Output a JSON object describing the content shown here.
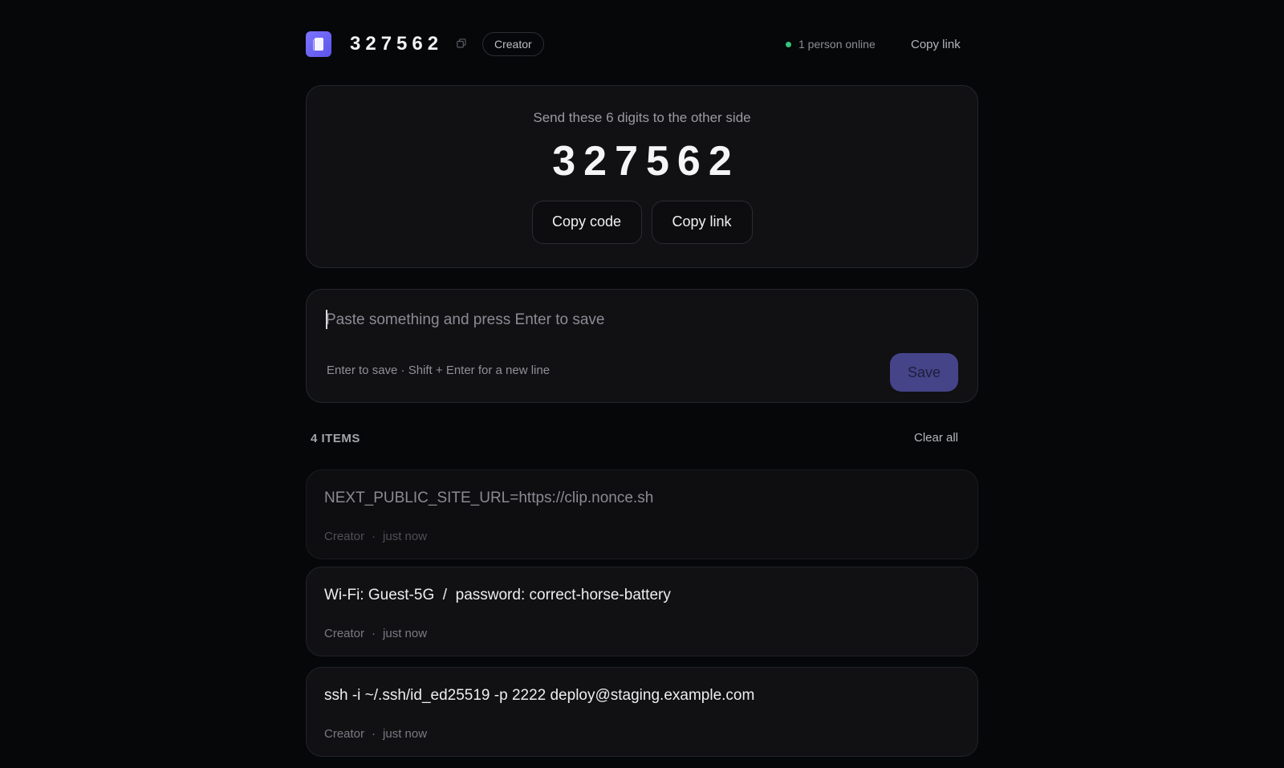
{
  "header": {
    "room_code": "327562",
    "role_badge": "Creator",
    "presence": "1 person online",
    "copy_link": "Copy link"
  },
  "code_card": {
    "instruction": "Send these 6 digits to the other side",
    "code": "327562",
    "copy_code_label": "Copy code",
    "copy_link_label": "Copy link"
  },
  "composer": {
    "placeholder": "Paste something and press Enter to save",
    "value": "",
    "hint": "Enter to save · Shift + Enter for a new line",
    "save_label": "Save"
  },
  "list": {
    "count_label": "4 ITEMS",
    "clear_label": "Clear all",
    "items": [
      {
        "text": "NEXT_PUBLIC_SITE_URL=https://clip.nonce.sh",
        "author": "Creator",
        "sep": "·",
        "time": "just now"
      },
      {
        "text": "Wi-Fi: Guest-5G  /  password: correct-horse-battery",
        "author": "Creator",
        "sep": "·",
        "time": "just now"
      },
      {
        "text": "ssh -i ~/.ssh/id_ed25519 -p 2222 deploy@staging.example.com",
        "author": "Creator",
        "sep": "·",
        "time": "just now"
      }
    ]
  },
  "colors": {
    "background": "#060709",
    "accent": "#5b54e8",
    "save_button": "#454489",
    "online_dot": "#34c47c"
  },
  "icons": {
    "logo": "clipboard-logo-icon",
    "copy": "copy-icon",
    "status": "online-dot-icon"
  }
}
